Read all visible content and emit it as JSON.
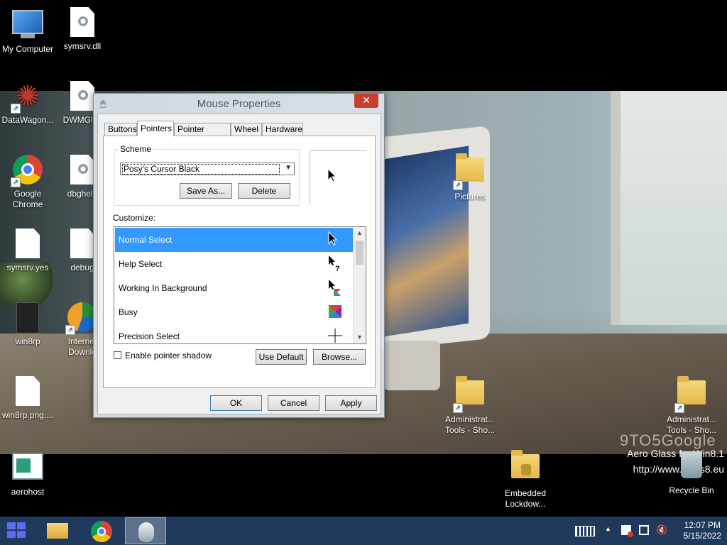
{
  "desktop": {
    "icons": [
      {
        "label": "My Computer"
      },
      {
        "label": "symsrv.dll"
      },
      {
        "label": "DataWagon..."
      },
      {
        "label": "DWMGlas"
      },
      {
        "label": "Google Chrome"
      },
      {
        "label": "dbghelp"
      },
      {
        "label": "symsrv.yes"
      },
      {
        "label": "debug"
      },
      {
        "label": "win8rp"
      },
      {
        "label": "Internet Downlo"
      },
      {
        "label": "win8rp.png...."
      },
      {
        "label": "aerohost"
      },
      {
        "label": "Pictures"
      },
      {
        "label": "Administrat... Tools - Sho..."
      },
      {
        "label": "Administrat... Tools - Sho..."
      },
      {
        "label": "Embedded Lockdow..."
      },
      {
        "label": "Recycle Bin"
      }
    ],
    "watermark": "9TO5Google",
    "aero_line1": "Aero Glass for Win8.1",
    "aero_line2": "http://www.glass8.eu"
  },
  "dialog": {
    "title": "Mouse Properties",
    "close_glyph": "✕",
    "tabs": [
      "Buttons",
      "Pointers",
      "Pointer Options",
      "Wheel",
      "Hardware"
    ],
    "active_tab": "Pointers",
    "scheme": {
      "legend": "Scheme",
      "selected": "Posy's Cursor Black",
      "save_as": "Save As...",
      "delete": "Delete"
    },
    "customize_label": "Customize:",
    "cursor_list": [
      {
        "label": "Normal Select",
        "icon": "arrow-cursor-icon",
        "selected": true
      },
      {
        "label": "Help Select",
        "icon": "help-cursor-icon",
        "selected": false
      },
      {
        "label": "Working In Background",
        "icon": "working-cursor-icon",
        "selected": false
      },
      {
        "label": "Busy",
        "icon": "busy-cursor-icon",
        "selected": false
      },
      {
        "label": "Precision Select",
        "icon": "crosshair-cursor-icon",
        "selected": false
      }
    ],
    "enable_shadow_label": "Enable pointer shadow",
    "enable_shadow_checked": false,
    "use_default": "Use Default",
    "browse": "Browse...",
    "ok": "OK",
    "cancel": "Cancel",
    "apply": "Apply"
  },
  "taskbar": {
    "time": "12:07 PM",
    "date": "5/15/2022"
  },
  "colors": {
    "selection": "#3399ff",
    "taskbar": "#1f3a5c",
    "close_button": "#c7402e"
  }
}
